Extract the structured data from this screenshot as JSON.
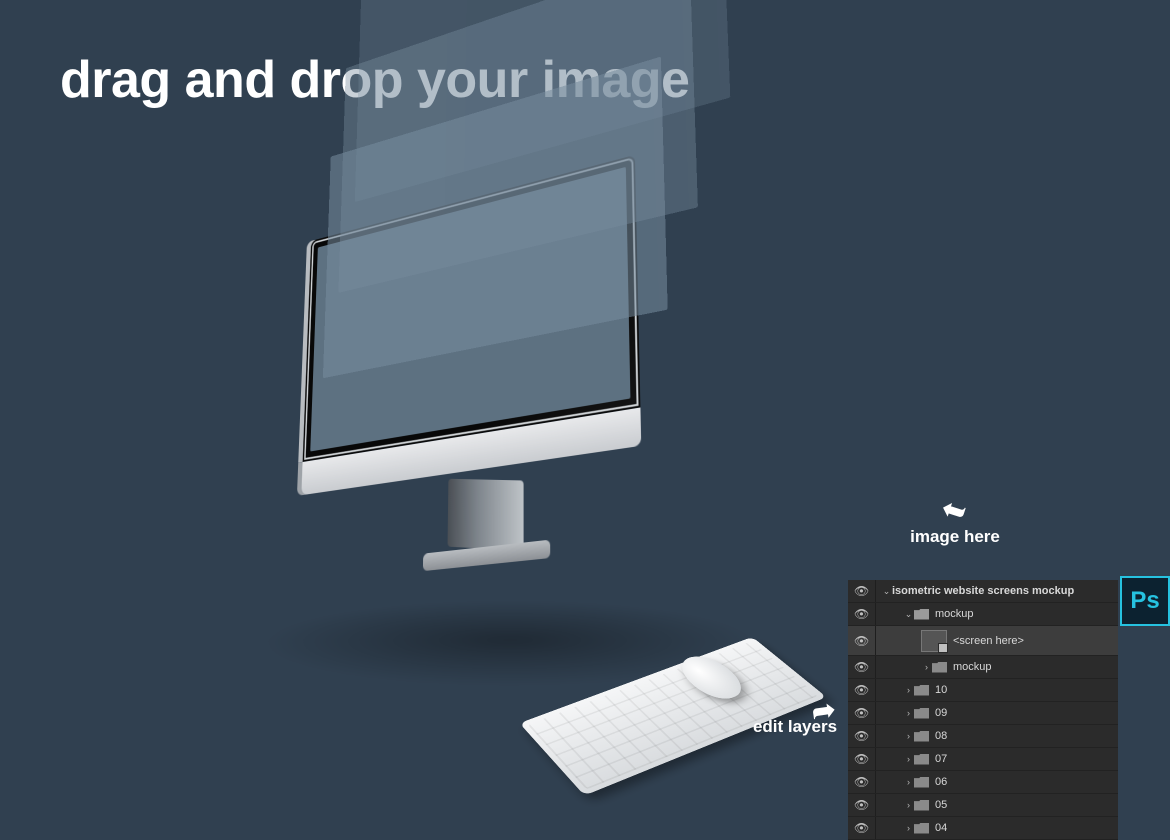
{
  "headline": "drag and drop your image",
  "annotations": {
    "image_here": "image here",
    "edit_layers": "edit layers"
  },
  "app_icon": "Ps",
  "layers": {
    "root": "isometric website screens mockup",
    "group1": "mockup",
    "smart": "<screen here>",
    "group2": "mockup",
    "folders": [
      "10",
      "09",
      "08",
      "07",
      "06",
      "05",
      "04"
    ]
  }
}
